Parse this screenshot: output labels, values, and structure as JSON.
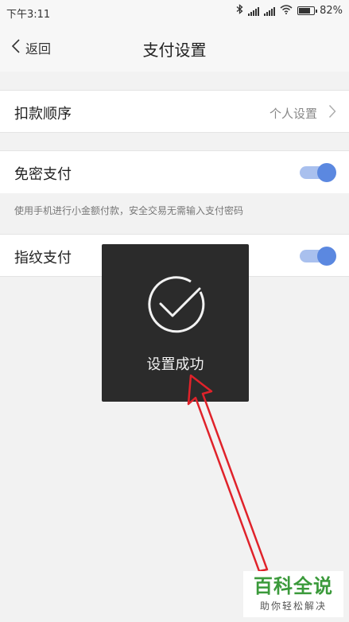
{
  "status_bar": {
    "time": "下午3:11",
    "battery_percent_label": "82%",
    "battery_level": 0.82
  },
  "nav": {
    "back_label": "返回",
    "title": "支付设置"
  },
  "settings": {
    "deduct_order": {
      "label": "扣款顺序",
      "value": "个人设置"
    },
    "password_free": {
      "label": "免密支付",
      "enabled": true,
      "hint": "使用手机进行小金额付款，安全交易无需输入支付密码"
    },
    "fingerprint": {
      "label": "指纹支付",
      "enabled": true
    }
  },
  "toast": {
    "message": "设置成功"
  },
  "watermark": {
    "main": "百科全说",
    "sub": "助你轻松解决"
  },
  "colors": {
    "toggle_on": "#5b88e0",
    "arrow": "#e0222a",
    "watermark_green": "#3b9a3b"
  }
}
